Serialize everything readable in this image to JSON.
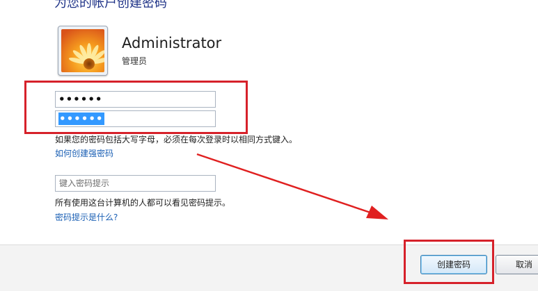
{
  "dialog": {
    "heading": "为您的帐户创建密码"
  },
  "user": {
    "name": "Administrator",
    "role": "管理员",
    "avatar_icon": "flower-avatar-icon"
  },
  "form": {
    "password_value": "••••••",
    "confirm_value": "••••••",
    "caps_note": "如果您的密码包括大写字母，必须在每次登录时以相同方式键入。",
    "strong_password_link": "如何创建强密码",
    "hint_placeholder": "键入密码提示",
    "hint_note": "所有使用这台计算机的人都可以看见密码提示。",
    "hint_help_link": "密码提示是什么?"
  },
  "buttons": {
    "create": "创建密码",
    "cancel": "取消"
  },
  "annotations": {
    "highlight_color": "#d6212a",
    "arrow_color": "#e02020"
  }
}
